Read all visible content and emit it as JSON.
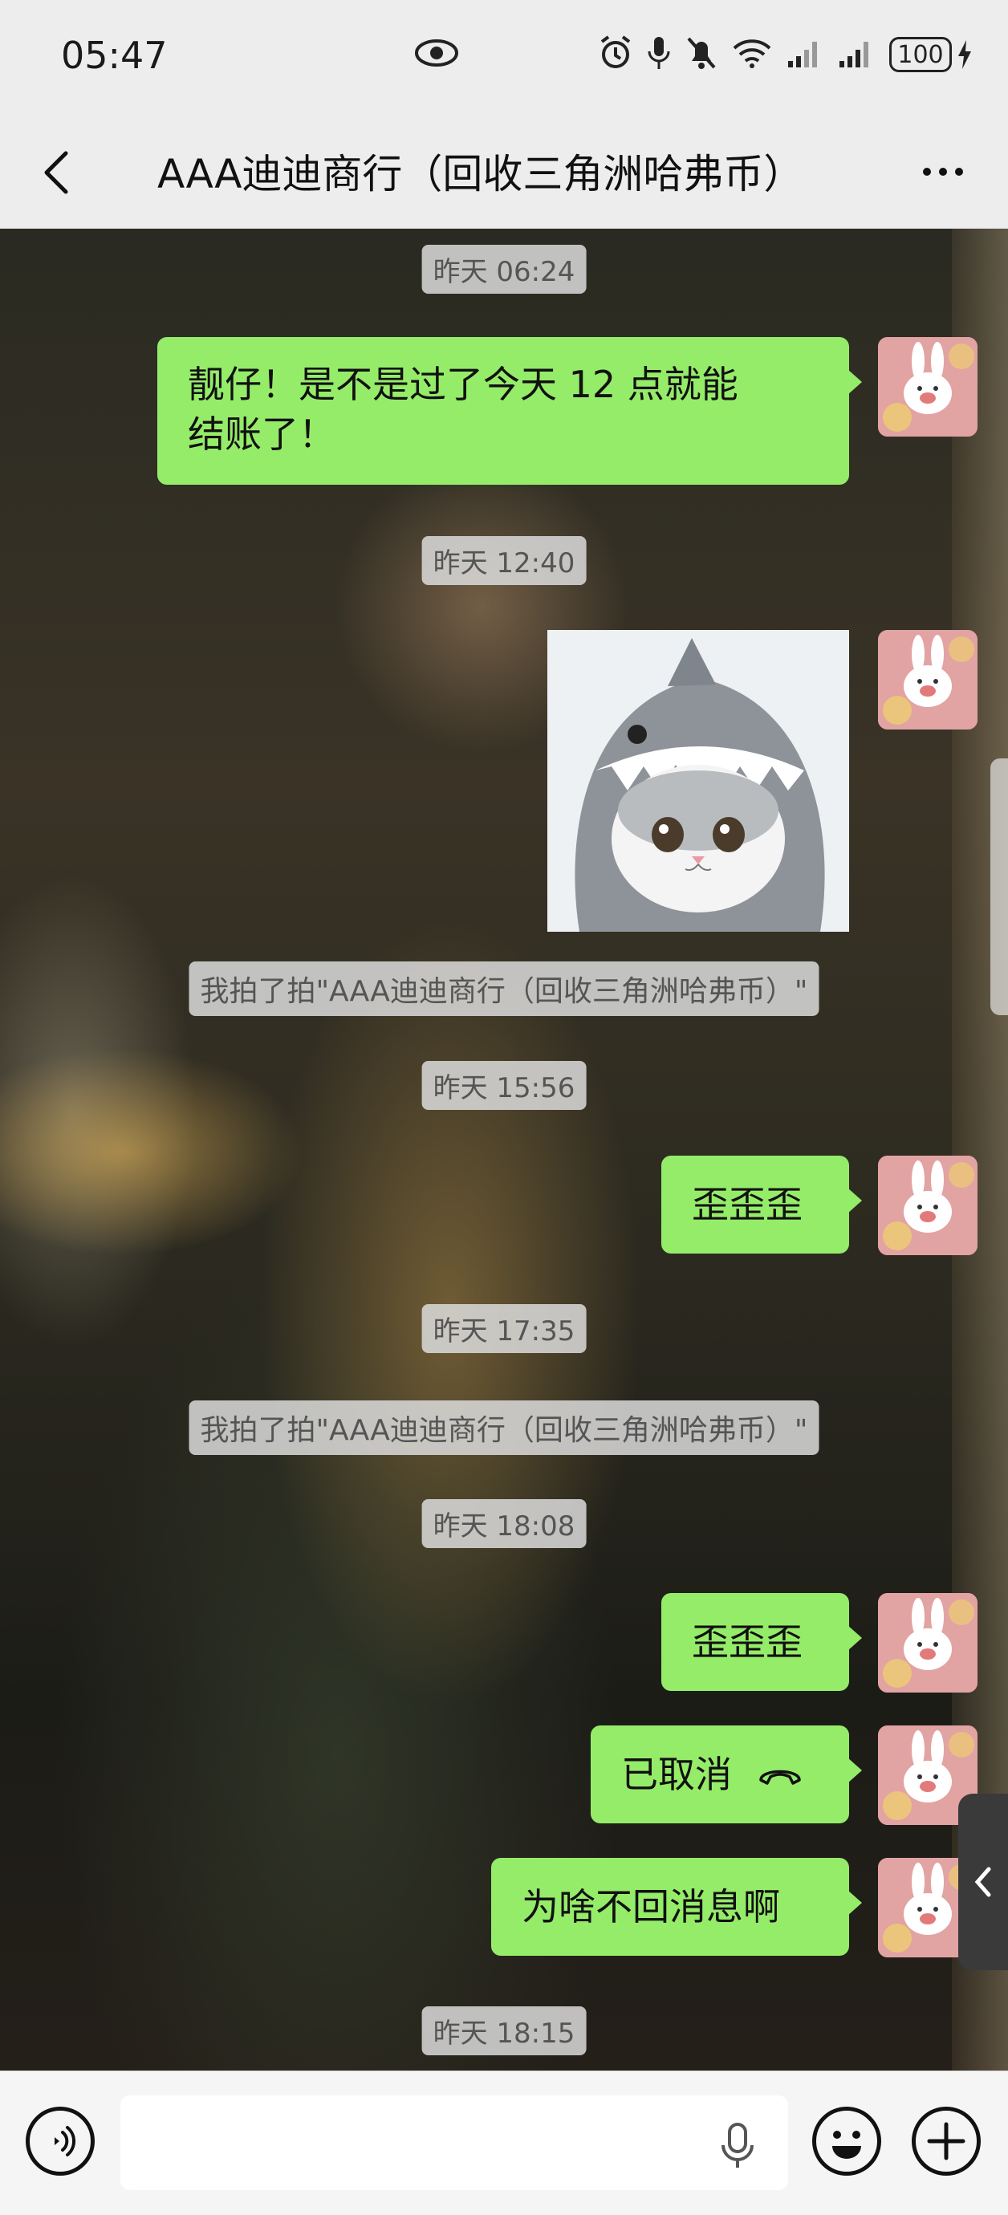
{
  "status_bar": {
    "time": "05:47",
    "battery": "100",
    "icons": [
      "eye-icon",
      "alarm-icon",
      "mic-icon",
      "mute-icon",
      "wifi-icon",
      "signal-icon",
      "signal-icon",
      "battery-icon",
      "charging-icon"
    ]
  },
  "header": {
    "title": "AAA迪迪商行（回收三角洲哈弗币）",
    "back_icon": "back-arrow-icon",
    "more_icon": "more-dots-icon"
  },
  "messages": [
    {
      "type": "time",
      "text": "昨天 06:24"
    },
    {
      "type": "text",
      "side": "out",
      "lines": [
        "靓仔！是不是过了今天 12 点就能",
        "结账了！"
      ]
    },
    {
      "type": "time",
      "text": "昨天 12:40"
    },
    {
      "type": "image",
      "side": "out",
      "desc": "cat-in-shark-hat-sticker"
    },
    {
      "type": "system",
      "text": "我拍了拍\"AAA迪迪商行（回收三角洲哈弗币）\""
    },
    {
      "type": "time",
      "text": "昨天 15:56"
    },
    {
      "type": "text",
      "side": "out",
      "lines": [
        "歪歪歪"
      ]
    },
    {
      "type": "time",
      "text": "昨天 17:35"
    },
    {
      "type": "system",
      "text": "我拍了拍\"AAA迪迪商行（回收三角洲哈弗币）\""
    },
    {
      "type": "time",
      "text": "昨天 18:08"
    },
    {
      "type": "text",
      "side": "out",
      "lines": [
        "歪歪歪"
      ]
    },
    {
      "type": "call",
      "side": "out",
      "text": "已取消"
    },
    {
      "type": "text",
      "side": "out",
      "lines": [
        "为啥不回消息啊"
      ]
    },
    {
      "type": "time",
      "text": "昨天 18:15"
    }
  ],
  "input_bar": {
    "voice_icon": "voice-toggle-icon",
    "input_placeholder": "",
    "mic_icon": "mic-icon",
    "emoji_icon": "emoji-icon",
    "plus_icon": "plus-icon"
  },
  "colors": {
    "bubble_out": "#95ec69",
    "header_bg": "#ededed",
    "chip_bg": "#dcdcdc"
  }
}
